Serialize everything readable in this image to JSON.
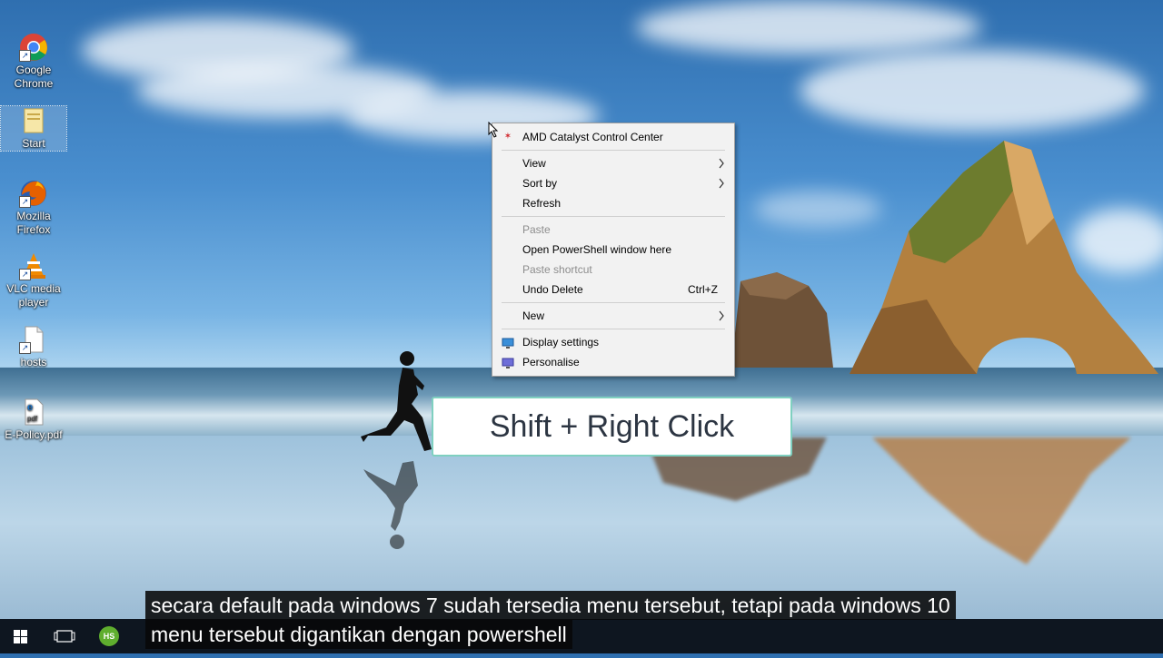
{
  "desktop": {
    "icons": [
      {
        "label_1": "Google",
        "label_2": "Chrome"
      },
      {
        "label_1": "Start",
        "label_2": ""
      },
      {
        "label_1": "Mozilla",
        "label_2": "Firefox"
      },
      {
        "label_1": "VLC media",
        "label_2": "player"
      },
      {
        "label_1": "hosts",
        "label_2": ""
      },
      {
        "label_1": "E-Policy.pdf",
        "label_2": ""
      }
    ]
  },
  "context_menu": {
    "amd": "AMD Catalyst Control Center",
    "view": "View",
    "sort_by": "Sort by",
    "refresh": "Refresh",
    "paste": "Paste",
    "open_powershell": "Open PowerShell window here",
    "paste_shortcut": "Paste shortcut",
    "undo_delete": "Undo Delete",
    "undo_shortcut": "Ctrl+Z",
    "new": "New",
    "display_settings": "Display settings",
    "personalise": "Personalise"
  },
  "overlay": {
    "caption": "Shift + Right Click"
  },
  "subtitles": {
    "line1": "secara default pada windows 7 sudah tersedia menu tersebut, tetapi pada windows 10",
    "line2": "menu tersebut digantikan dengan powershell"
  },
  "taskbar": {
    "hs_badge": "HS"
  }
}
